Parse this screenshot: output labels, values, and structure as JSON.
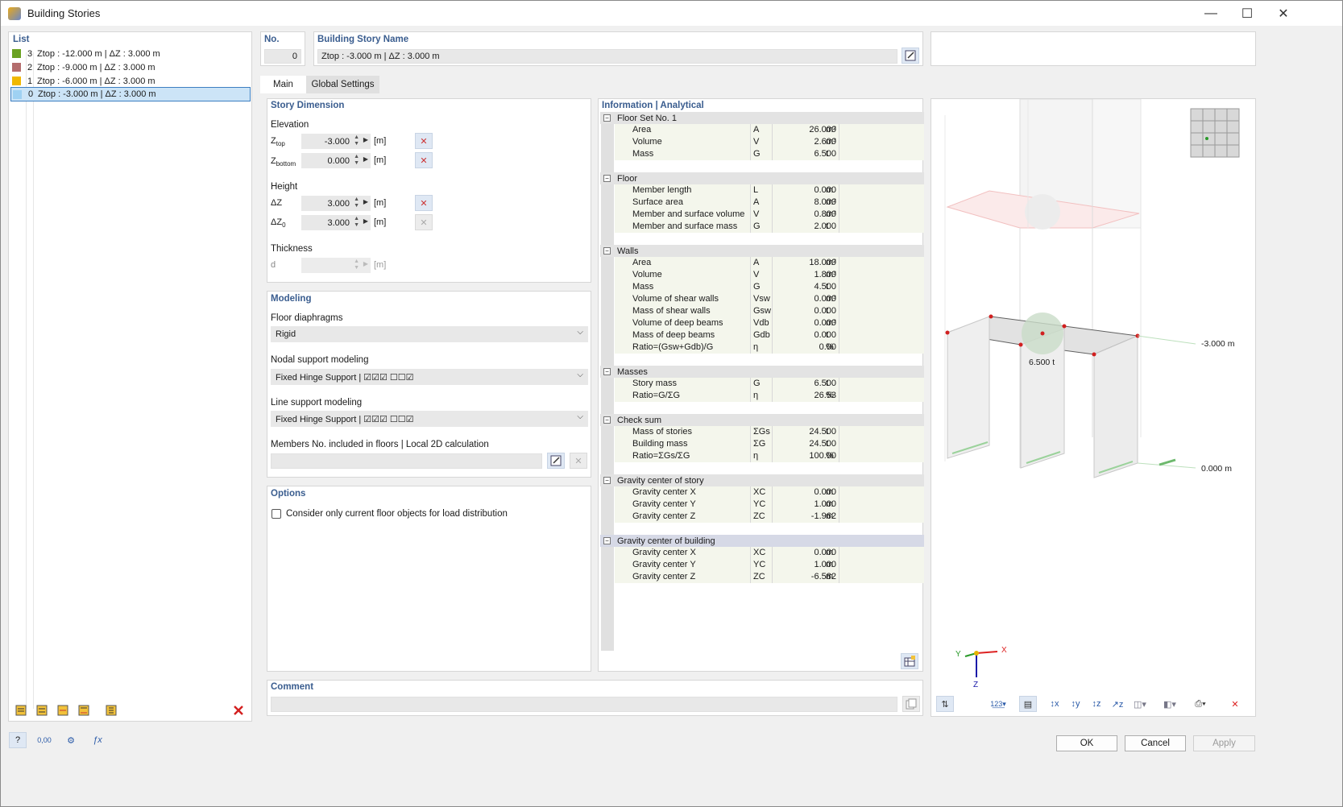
{
  "window": {
    "title": "Building Stories",
    "controls": [
      "—",
      "☐",
      "✕"
    ]
  },
  "list": {
    "header": "List",
    "items": [
      {
        "num": "3",
        "text": "Ztop : -12.000 m | ΔZ : 3.000 m",
        "color": "#6aa121"
      },
      {
        "num": "2",
        "text": "Ztop : -9.000 m | ΔZ : 3.000 m",
        "color": "#b46d6d"
      },
      {
        "num": "1",
        "text": "Ztop : -6.000 m | ΔZ : 3.000 m",
        "color": "#f0b800"
      },
      {
        "num": "0",
        "text": "Ztop : -3.000 m | ΔZ : 3.000 m",
        "color": "#9fd1f2"
      }
    ],
    "selected_index": 3
  },
  "header": {
    "no_label": "No.",
    "no_value": "0",
    "name_label": "Building Story Name",
    "name_value": "Ztop : -3.000 m | ΔZ : 3.000 m"
  },
  "tabs": [
    {
      "label": "Main",
      "active": true
    },
    {
      "label": "Global Settings",
      "active": false
    }
  ],
  "story_dimension": {
    "title": "Story Dimension",
    "elevation_label": "Elevation",
    "ztop_label": "Ztop",
    "ztop_value": "-3.000",
    "zbottom_label": "Zbottom",
    "zbottom_value": "0.000",
    "height_label": "Height",
    "dz_label": "ΔZ",
    "dz_value": "3.000",
    "dz0_label": "ΔZ0",
    "dz0_value": "3.000",
    "thickness_label": "Thickness",
    "d_label": "d",
    "d_value": "",
    "unit": "[m]"
  },
  "modeling": {
    "title": "Modeling",
    "floor_diaphragms_label": "Floor diaphragms",
    "floor_diaphragms_value": "Rigid",
    "nodal_support_label": "Nodal support modeling",
    "nodal_support_value": "Fixed Hinge Support | ☑☑☑ ☐☐☑",
    "line_support_label": "Line support modeling",
    "line_support_value": "Fixed Hinge Support | ☑☑☑ ☐☐☑",
    "members_label": "Members No. included in floors | Local 2D calculation",
    "members_value": ""
  },
  "options": {
    "title": "Options",
    "consider_label": "Consider only current floor objects for load distribution",
    "consider_checked": false
  },
  "comment": {
    "title": "Comment",
    "value": ""
  },
  "info": {
    "title": "Information | Analytical",
    "sections": [
      {
        "title": "Floor Set No. 1",
        "rows": [
          {
            "name": "Area",
            "sym": "A",
            "val": "26.000",
            "unit": "m²"
          },
          {
            "name": "Volume",
            "sym": "V",
            "val": "2.600",
            "unit": "m³"
          },
          {
            "name": "Mass",
            "sym": "G",
            "val": "6.500",
            "unit": "t"
          }
        ]
      },
      {
        "title": "Floor",
        "rows": [
          {
            "name": "Member length",
            "sym": "L",
            "val": "0.000",
            "unit": "m"
          },
          {
            "name": "Surface area",
            "sym": "A",
            "val": "8.000",
            "unit": "m²"
          },
          {
            "name": "Member and surface volume",
            "sym": "V",
            "val": "0.800",
            "unit": "m³"
          },
          {
            "name": "Member and surface mass",
            "sym": "G",
            "val": "2.000",
            "unit": "t"
          }
        ]
      },
      {
        "title": "Walls",
        "rows": [
          {
            "name": "Area",
            "sym": "A",
            "val": "18.000",
            "unit": "m²"
          },
          {
            "name": "Volume",
            "sym": "V",
            "val": "1.800",
            "unit": "m³"
          },
          {
            "name": "Mass",
            "sym": "G",
            "val": "4.500",
            "unit": "t"
          },
          {
            "name": "Volume of shear walls",
            "sym": "Vsw",
            "val": "0.000",
            "unit": "m³"
          },
          {
            "name": "Mass of shear walls",
            "sym": "Gsw",
            "val": "0.000",
            "unit": "t"
          },
          {
            "name": "Volume of deep beams",
            "sym": "Vdb",
            "val": "0.000",
            "unit": "m³"
          },
          {
            "name": "Mass of deep beams",
            "sym": "Gdb",
            "val": "0.000",
            "unit": "t"
          },
          {
            "name": "Ratio=(Gsw+Gdb)/G",
            "sym": "η",
            "val": "0.00",
            "unit": "%"
          }
        ]
      },
      {
        "title": "Masses",
        "rows": [
          {
            "name": "Story mass",
            "sym": "G",
            "val": "6.500",
            "unit": "t"
          },
          {
            "name": "Ratio=G/ΣG",
            "sym": "η",
            "val": "26.53",
            "unit": "%"
          }
        ]
      },
      {
        "title": "Check sum",
        "rows": [
          {
            "name": "Mass of stories",
            "sym": "ΣGs",
            "val": "24.500",
            "unit": "t"
          },
          {
            "name": "Building mass",
            "sym": "ΣG",
            "val": "24.500",
            "unit": "t"
          },
          {
            "name": "Ratio=ΣGs/ΣG",
            "sym": "η",
            "val": "100.00",
            "unit": "%"
          }
        ]
      },
      {
        "title": "Gravity center of story",
        "rows": [
          {
            "name": "Gravity center X",
            "sym": "XC",
            "val": "0.000",
            "unit": "m"
          },
          {
            "name": "Gravity center Y",
            "sym": "YC",
            "val": "1.000",
            "unit": "m"
          },
          {
            "name": "Gravity center Z",
            "sym": "ZC",
            "val": "-1.962",
            "unit": "m"
          }
        ]
      },
      {
        "title": "Gravity center of building",
        "highlight": true,
        "rows": [
          {
            "name": "Gravity center X",
            "sym": "XC",
            "val": "0.000",
            "unit": "m"
          },
          {
            "name": "Gravity center Y",
            "sym": "YC",
            "val": "1.000",
            "unit": "m"
          },
          {
            "name": "Gravity center Z",
            "sym": "ZC",
            "val": "-6.582",
            "unit": "m"
          }
        ]
      }
    ]
  },
  "viewport": {
    "mass_label": "6.500 t",
    "level_top": "-3.000 m",
    "level_bottom": "0.000 m",
    "axis_x": "X",
    "axis_y": "Y",
    "axis_z": "Z"
  },
  "footer": {
    "ok": "OK",
    "cancel": "Cancel",
    "apply": "Apply"
  }
}
